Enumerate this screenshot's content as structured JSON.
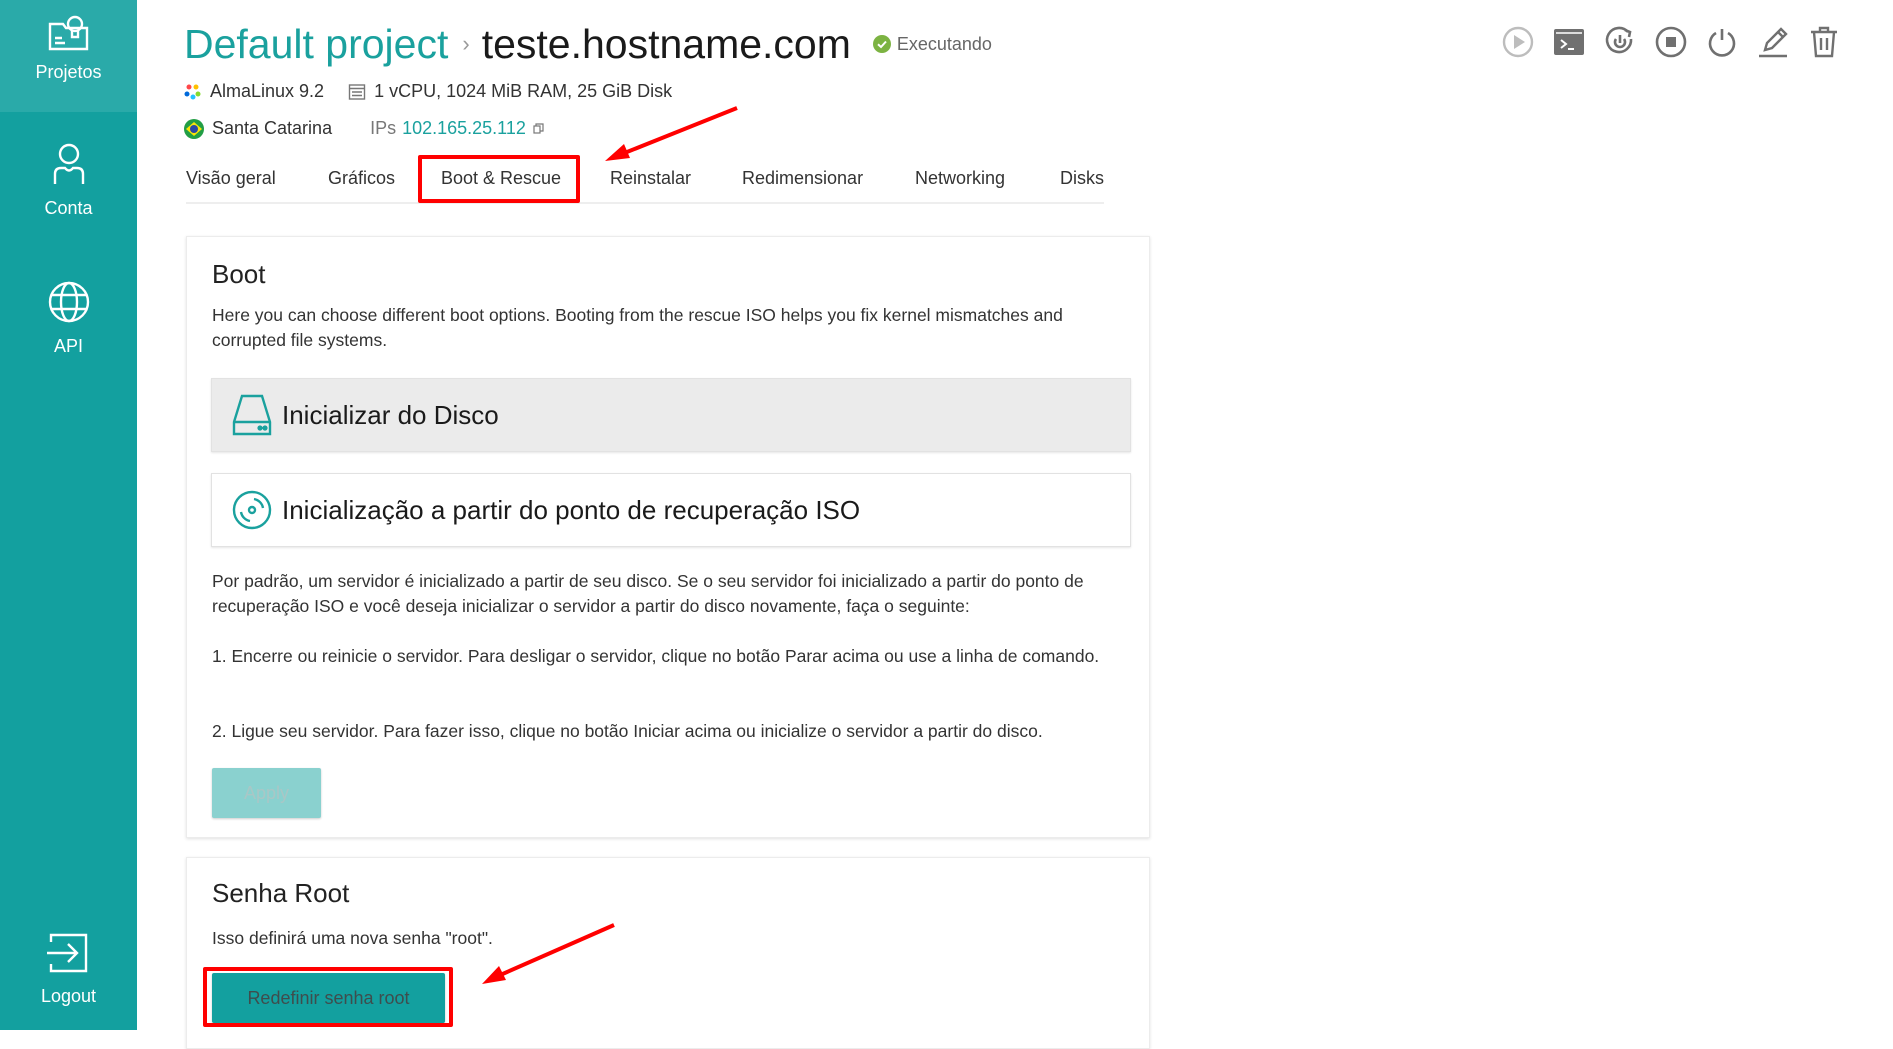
{
  "sidebar": {
    "items": [
      {
        "label": "Projetos",
        "icon": "projects-icon",
        "active": true
      },
      {
        "label": "Conta",
        "icon": "user-icon"
      },
      {
        "label": "API",
        "icon": "globe-icon"
      },
      {
        "label": "Logout",
        "icon": "logout-icon"
      }
    ]
  },
  "header": {
    "project": "Default project",
    "separator": "›",
    "hostname": "teste.hostname.com",
    "status": "Executando",
    "status_color": "#7cb342"
  },
  "meta": {
    "os": "AlmaLinux 9.2",
    "specs": "1 vCPU, 1024 MiB RAM, 25 GiB Disk",
    "location": "Santa Catarina",
    "ips_label": "IPs",
    "ip": "102.165.25.112"
  },
  "toolbar": {
    "icons": [
      "play-icon",
      "console-icon",
      "restart-icon",
      "stop-icon",
      "power-icon",
      "edit-icon",
      "trash-icon"
    ]
  },
  "tabs": [
    {
      "label": "Visão geral"
    },
    {
      "label": "Gráficos"
    },
    {
      "label": "Boot & Rescue",
      "active": true
    },
    {
      "label": "Reinstalar"
    },
    {
      "label": "Redimensionar"
    },
    {
      "label": "Networking"
    },
    {
      "label": "Disks"
    }
  ],
  "boot": {
    "title": "Boot",
    "description": "Here you can choose different boot options. Booting from the rescue ISO helps you fix kernel mismatches and corrupted file systems.",
    "options": [
      {
        "label": "Inicializar do Disco",
        "selected": true
      },
      {
        "label": "Inicialização a partir do ponto de recuperação ISO",
        "selected": false
      }
    ],
    "info": "Por padrão, um servidor é inicializado a partir de seu disco. Se o seu servidor foi inicializado a partir do ponto de recuperação ISO e você deseja inicializar o servidor a partir do disco novamente, faça o seguinte:",
    "step1": "1. Encerre ou reinicie o servidor. Para desligar o servidor, clique no botão Parar acima ou use a linha de comando.",
    "step2": "2. Ligue seu servidor. Para fazer isso, clique no botão Iniciar acima ou inicialize o servidor a partir do disco.",
    "apply_label": "Apply"
  },
  "root_password": {
    "title": "Senha Root",
    "description": "Isso definirá uma nova senha \"root\".",
    "button_label": "Redefinir senha root"
  },
  "colors": {
    "brand": "#13a09f",
    "annotation": "#ff0000"
  }
}
